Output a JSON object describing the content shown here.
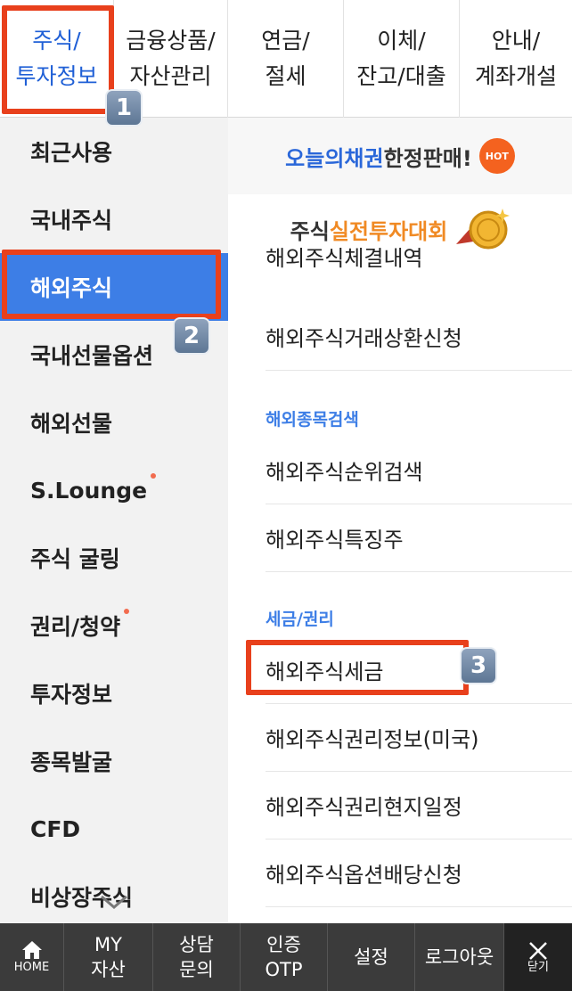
{
  "top_tabs": [
    {
      "label": "주식/\n투자정보"
    },
    {
      "label": "금융상품/\n자산관리"
    },
    {
      "label": "연금/\n절세"
    },
    {
      "label": "이체/\n잔고/대출"
    },
    {
      "label": "안내/\n계좌개설"
    }
  ],
  "sidebar": {
    "items": [
      {
        "label": "최근사용"
      },
      {
        "label": "국내주식"
      },
      {
        "label": "해외주식"
      },
      {
        "label": "국내선물옵션"
      },
      {
        "label": "해외선물"
      },
      {
        "label": "S.Lounge"
      },
      {
        "label": "주식 굴링"
      },
      {
        "label": "권리/청약"
      },
      {
        "label": "투자정보"
      },
      {
        "label": "종목발굴"
      },
      {
        "label": "CFD"
      },
      {
        "label": "비상장주식"
      }
    ]
  },
  "banners": {
    "b1_accent": "오늘의채권",
    "b1_rest": " 한정판매!",
    "b1_badge": "HOT",
    "b2_prefix": "주식 ",
    "b2_accent": "실전투자대회"
  },
  "menu": {
    "cut_item": "해외주식체결내역",
    "item1": "해외주식거래상환신청",
    "section1": "해외종목검색",
    "item2": "해외주식순위검색",
    "item3": "해외주식특징주",
    "section2": "세금/권리",
    "item4": "해외주식세금",
    "item5": "해외주식권리정보(미국)",
    "item6": "해외주식권리현지일정",
    "item7": "해외주식옵션배당신청"
  },
  "badges": {
    "one": "1",
    "two": "2",
    "three": "3"
  },
  "bottom_bar": {
    "home": "HOME",
    "my": "MY\n자산",
    "consult": "상담\n문의",
    "otp": "인증\nOTP",
    "settings": "설정",
    "logout": "로그아웃",
    "close": "닫기"
  },
  "colors": {
    "accent_blue": "#3d7ee6",
    "highlight_red": "#e8401c",
    "bottom_bar": "#3b3b3b"
  }
}
